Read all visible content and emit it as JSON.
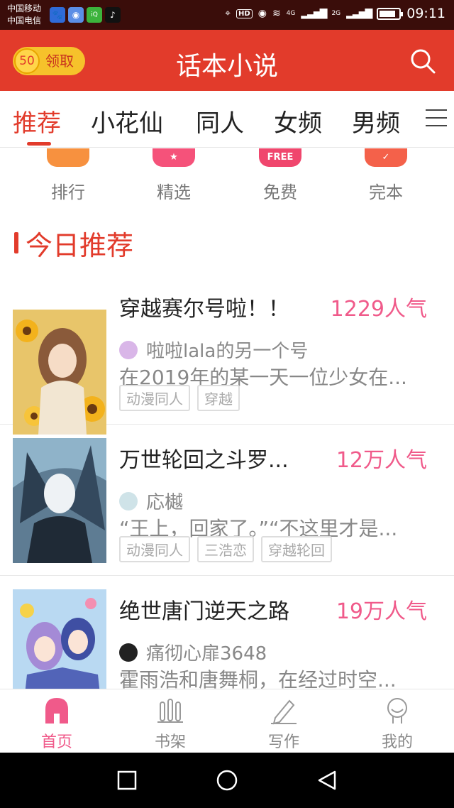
{
  "status_bar": {
    "carrier1": "中国移动",
    "carrier2": "中国电信",
    "app_icons": [
      "paw-icon",
      "browser-icon",
      "iqiyi-icon",
      "tiktok-icon"
    ],
    "hd": "HD",
    "net1": "4G",
    "net2": "2G",
    "battery_level": 0.85,
    "time": "09:11"
  },
  "header": {
    "coin_value": "50",
    "coin_label": "领取",
    "title": "话本小说"
  },
  "tabs": {
    "items": [
      "推荐",
      "小花仙",
      "同人",
      "女频",
      "男频"
    ],
    "active_index": 0
  },
  "categories": [
    {
      "label": "排行",
      "color": "#f7913f",
      "glyph": ""
    },
    {
      "label": "精选",
      "color": "#f5527a",
      "glyph": "★"
    },
    {
      "label": "免费",
      "color": "#f0466d",
      "glyph": "FREE"
    },
    {
      "label": "完本",
      "color": "#f4614a",
      "glyph": "✓"
    }
  ],
  "section": {
    "title": "今日推荐"
  },
  "books": [
    {
      "title": "穿越赛尔号啦！！",
      "popularity": "1229人气",
      "author": "啦啦lala的另一个号",
      "summary": "在2019年的某一天一位少女在...",
      "tags": [
        "动漫同人",
        "穿越"
      ]
    },
    {
      "title": "万世轮回之斗罗...",
      "popularity": "12万人气",
      "author": "応樾",
      "summary": "“王上，回家了。”“不这里才是...",
      "tags": [
        "动漫同人",
        "三浩恋",
        "穿越轮回"
      ]
    },
    {
      "title": "绝世唐门逆天之路",
      "popularity": "19万人气",
      "author": "痛彻心扉3648",
      "summary": "霍雨浩和唐舞桐，在经过时空...",
      "tags": []
    }
  ],
  "bottom_nav": {
    "items": [
      {
        "label": "首页",
        "icon": "home-icon"
      },
      {
        "label": "书架",
        "icon": "bookshelf-icon"
      },
      {
        "label": "写作",
        "icon": "pen-icon"
      },
      {
        "label": "我的",
        "icon": "profile-icon"
      }
    ],
    "active_index": 0
  },
  "colors": {
    "brand": "#e23b2b",
    "accent_pink": "#f05a8a"
  }
}
